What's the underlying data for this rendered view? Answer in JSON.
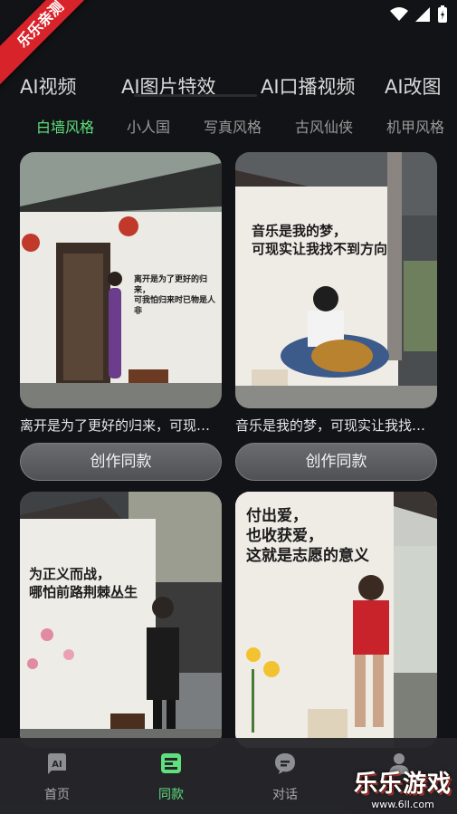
{
  "status": {
    "ribbon": "乐乐亲测"
  },
  "top_tabs": [
    "AI视频",
    "AI图片特效",
    "AI口播视频",
    "AI改图"
  ],
  "sub_tabs": [
    {
      "label": "白墙风格",
      "active": true
    },
    {
      "label": "小人国",
      "active": false
    },
    {
      "label": "写真风格",
      "active": false
    },
    {
      "label": "古风仙侠",
      "active": false
    },
    {
      "label": "机甲风格",
      "active": false
    }
  ],
  "cards": [
    {
      "caption": "离开是为了更好的归来，可现实生活常常事与愿违",
      "wall_text": "离开是为了更好的归来，\n可我怕归来时已物是人非",
      "button": "创作同款"
    },
    {
      "caption": "音乐是我的梦，可现实让我找不到方向",
      "wall_text": "音乐是我的梦，\n可现实让我找不到方向",
      "button": "创作同款"
    },
    {
      "caption": "",
      "wall_text": "为正义而战，\n哪怕前路荆棘丛生",
      "button": ""
    },
    {
      "caption": "",
      "wall_text": "付出爱，\n也收获爱，\n这就是志愿的意义",
      "button": ""
    }
  ],
  "nav": [
    {
      "label": "首页",
      "icon": "ai-home-icon",
      "active": false
    },
    {
      "label": "同款",
      "icon": "template-icon",
      "active": true
    },
    {
      "label": "对话",
      "icon": "chat-icon",
      "active": false
    },
    {
      "label": "",
      "icon": "profile-icon",
      "active": false
    }
  ],
  "watermark": {
    "main": "乐乐游戏",
    "url": "www.6ll.com"
  },
  "colors": {
    "accent": "#5fe07d",
    "background": "#121316"
  }
}
